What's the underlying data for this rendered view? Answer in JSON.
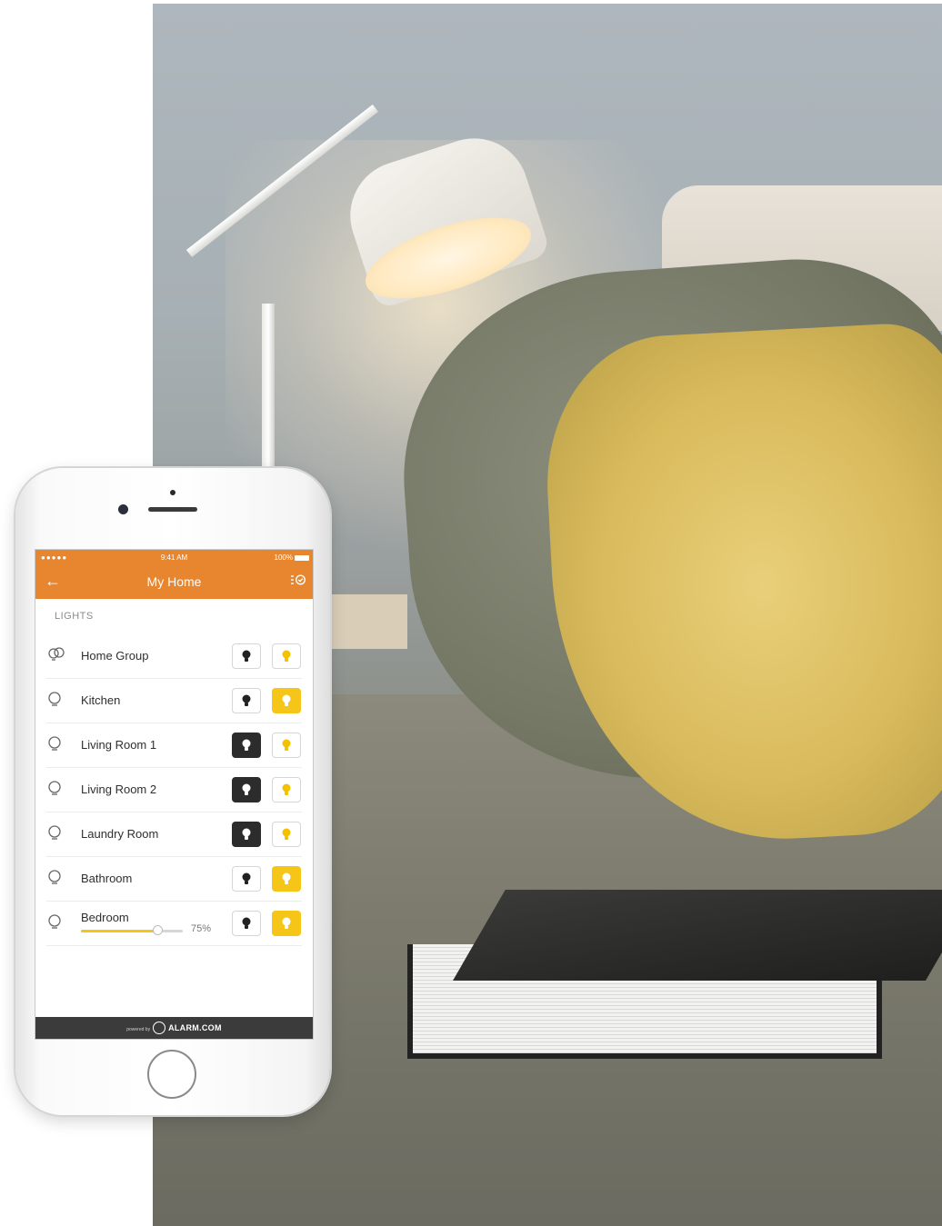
{
  "status_bar": {
    "signal": "●●●●● ",
    "time": "9:41 AM",
    "battery": "100%"
  },
  "app_bar": {
    "title": "My Home",
    "back_icon": "arrow-left-icon",
    "edit_icon": "list-check-icon"
  },
  "lights_section": {
    "label": "LIGHTS",
    "items": [
      {
        "name": "Home Group",
        "icon": "bulb-group-icon",
        "state": "on-partial"
      },
      {
        "name": "Kitchen",
        "icon": "bulb-icon",
        "state": "on"
      },
      {
        "name": "Living Room 1",
        "icon": "bulb-icon",
        "state": "off"
      },
      {
        "name": "Living Room 2",
        "icon": "bulb-icon",
        "state": "off"
      },
      {
        "name": "Laundry Room",
        "icon": "bulb-icon",
        "state": "off"
      },
      {
        "name": "Bathroom",
        "icon": "bulb-icon",
        "state": "on"
      },
      {
        "name": "Bedroom",
        "icon": "bulb-icon",
        "state": "on",
        "dimmer_percent": 75,
        "dimmer_label": "75%"
      }
    ]
  },
  "footer": {
    "powered_by": "powered by",
    "brand": "ALARM.COM"
  },
  "colors": {
    "app_bar": "#e8862f",
    "on_button": "#f5c518",
    "off_button_active": "#2c2c2c",
    "footer": "#3b3b3b"
  }
}
